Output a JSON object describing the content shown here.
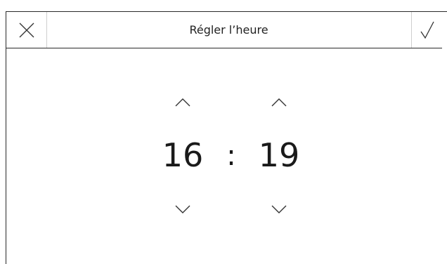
{
  "header": {
    "title": "Régler l’heure",
    "cancel_icon": "close-icon",
    "confirm_icon": "checkmark-icon"
  },
  "time": {
    "hours": "16",
    "separator": ":",
    "minutes": "19"
  },
  "icons": {
    "up": "chevron-up-icon",
    "down": "chevron-down-icon"
  }
}
